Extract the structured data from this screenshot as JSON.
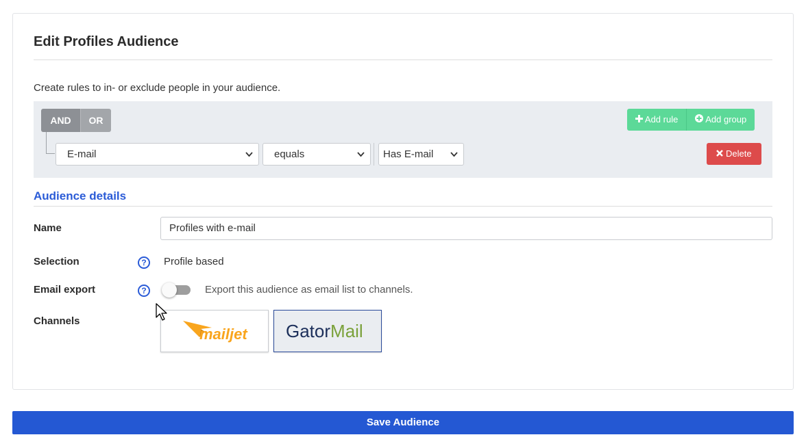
{
  "header": {
    "title": "Edit Profiles Audience"
  },
  "intro": "Create rules to in- or exclude people in your audience.",
  "query_builder": {
    "conjunctions": [
      "AND",
      "OR"
    ],
    "active_conjunction": "AND",
    "add_rule_label": "Add rule",
    "add_group_label": "Add group",
    "delete_label": "Delete",
    "rule": {
      "field": "E-mail",
      "operator": "equals",
      "value": "Has E-mail"
    }
  },
  "details": {
    "section_title": "Audience details",
    "name_label": "Name",
    "name_value": "Profiles with e-mail",
    "selection_label": "Selection",
    "selection_value": "Profile based",
    "email_export_label": "Email export",
    "email_export_enabled": false,
    "email_export_text": "Export this audience as email list to channels.",
    "channels_label": "Channels",
    "channels": [
      {
        "name": "mailjet",
        "selected": false
      },
      {
        "name": "GatorMail",
        "selected": true
      }
    ],
    "help_glyph": "?"
  },
  "save_label": "Save Audience",
  "colors": {
    "accent_blue": "#2458d3",
    "add_green": "#5cd998",
    "delete_red": "#dd4b4b",
    "conj_gray": "#8d9095"
  },
  "icons": {
    "plus": "plus-icon",
    "plus_circle": "plus-circle-icon",
    "times": "times-icon",
    "help": "help-circle-icon",
    "chevron": "chevron-down-icon"
  }
}
